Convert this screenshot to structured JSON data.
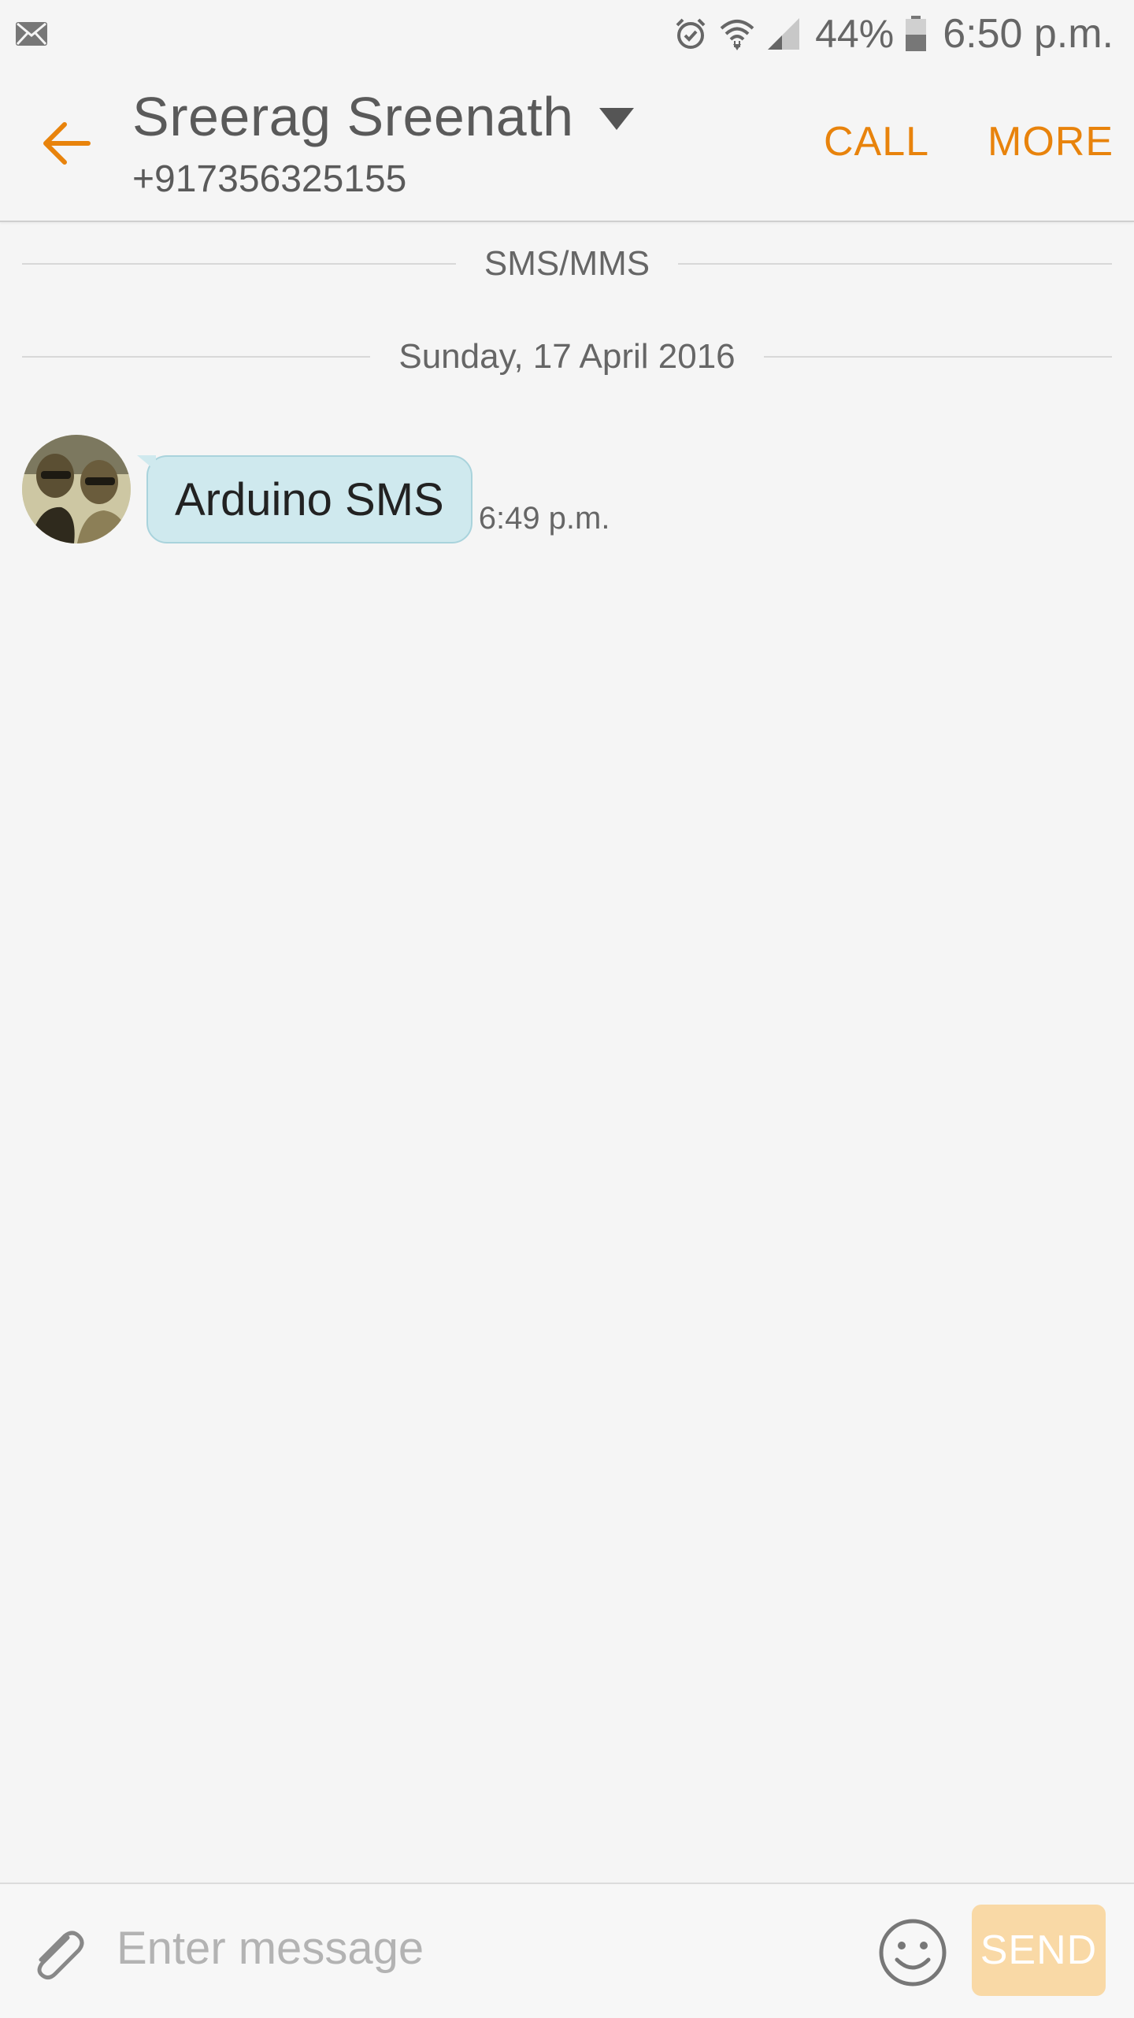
{
  "status_bar": {
    "battery_percent": "44%",
    "time": "6:50 p.m.",
    "icons": [
      "email-icon",
      "alarm-icon",
      "wifi-icon",
      "signal-icon",
      "battery-icon"
    ]
  },
  "header": {
    "contact_name": "Sreerag Sreenath",
    "phone_number": "+917356325155",
    "call_label": "CALL",
    "more_label": "MORE"
  },
  "conversation": {
    "type_label": "SMS/MMS",
    "date_label": "Sunday, 17 April 2016",
    "messages": [
      {
        "text": "Arduino SMS",
        "time": "6:49 p.m.",
        "direction": "incoming"
      }
    ]
  },
  "composer": {
    "placeholder": "Enter message",
    "send_label": "SEND"
  },
  "colors": {
    "accent": "#e8830c",
    "background": "#f5f5f5",
    "bubble": "#cfe9ee",
    "send_disabled": "#f9d9a6"
  }
}
